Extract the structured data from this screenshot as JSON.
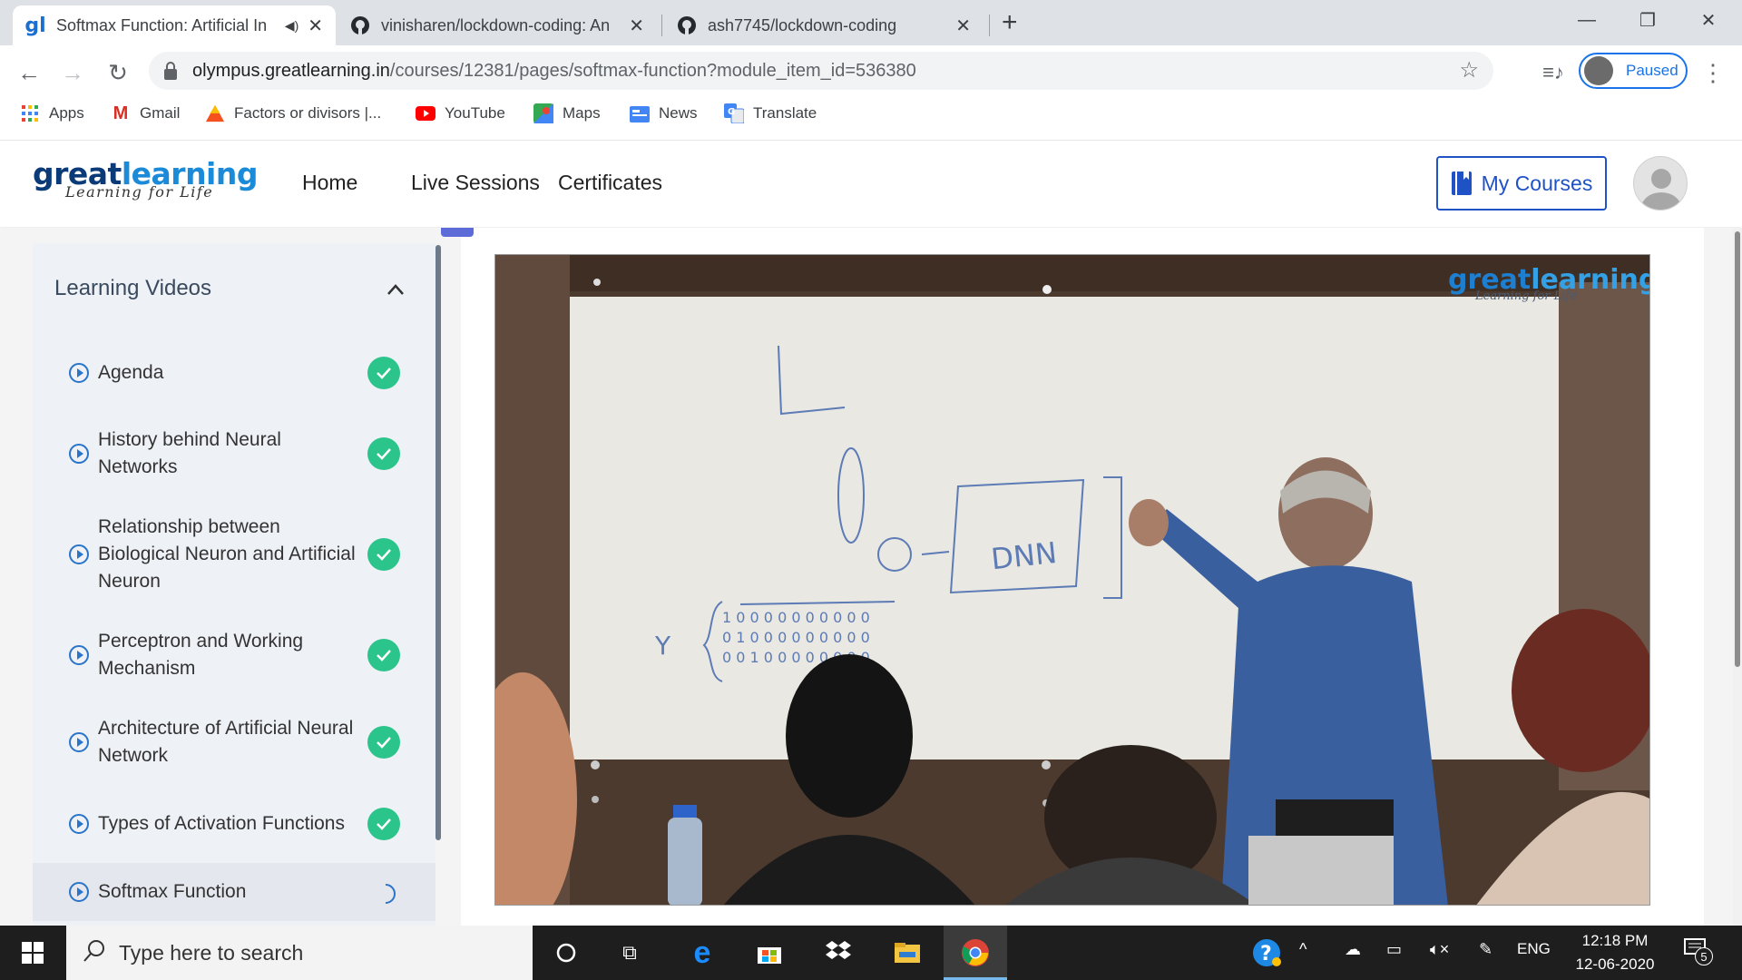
{
  "tabs": [
    {
      "title": "Softmax Function: Artificial In",
      "close": "✕"
    },
    {
      "title": "vinisharen/lockdown-coding: An",
      "close": "✕"
    },
    {
      "title": "ash7745/lockdown-coding",
      "close": "✕"
    }
  ],
  "new_tab": "+",
  "window": {
    "minimize": "—",
    "restore": "❐",
    "close": "✕"
  },
  "omnibox": {
    "host": "olympus.greatlearning.in",
    "path": "/courses/12381/pages/softmax-function?module_item_id=536380"
  },
  "profile": {
    "label": "Paused"
  },
  "bookmarks": [
    {
      "label": "Apps"
    },
    {
      "label": "Gmail"
    },
    {
      "label": "Factors or divisors |..."
    },
    {
      "label": "YouTube"
    },
    {
      "label": "Maps"
    },
    {
      "label": "News"
    },
    {
      "label": "Translate"
    }
  ],
  "site": {
    "logo_great": "great",
    "logo_learning": "learning",
    "tagline": "Learning for Life",
    "nav": [
      "Home",
      "Live Sessions",
      "Certificates"
    ],
    "my_courses": "My Courses"
  },
  "sidebar": {
    "title": "Learning Videos",
    "items": [
      {
        "label": "Agenda",
        "status": "complete"
      },
      {
        "label": "History behind Neural Networks",
        "status": "complete"
      },
      {
        "label": "Relationship between Biological Neuron and Artificial Neuron",
        "status": "complete"
      },
      {
        "label": "Perceptron and Working Mechanism",
        "status": "complete"
      },
      {
        "label": "Architecture of Artificial Neural Network",
        "status": "complete"
      },
      {
        "label": "Types of Activation Functions",
        "status": "complete"
      },
      {
        "label": "Softmax Function",
        "status": "in-progress"
      }
    ]
  },
  "video": {
    "watermark_great": "great",
    "watermark_learning": "learning",
    "watermark_tagline": "Learning for Life",
    "board_text": "DNN"
  },
  "taskbar": {
    "search_placeholder": "Type here to search",
    "language": "ENG",
    "time": "12:18 PM",
    "date": "12-06-2020",
    "notifications": "5"
  },
  "colors": {
    "brand_blue": "#1f52c5",
    "brand_logo": "#1b6fd1",
    "check_green": "#2bc48a",
    "taskbar": "#1e1e1e"
  }
}
